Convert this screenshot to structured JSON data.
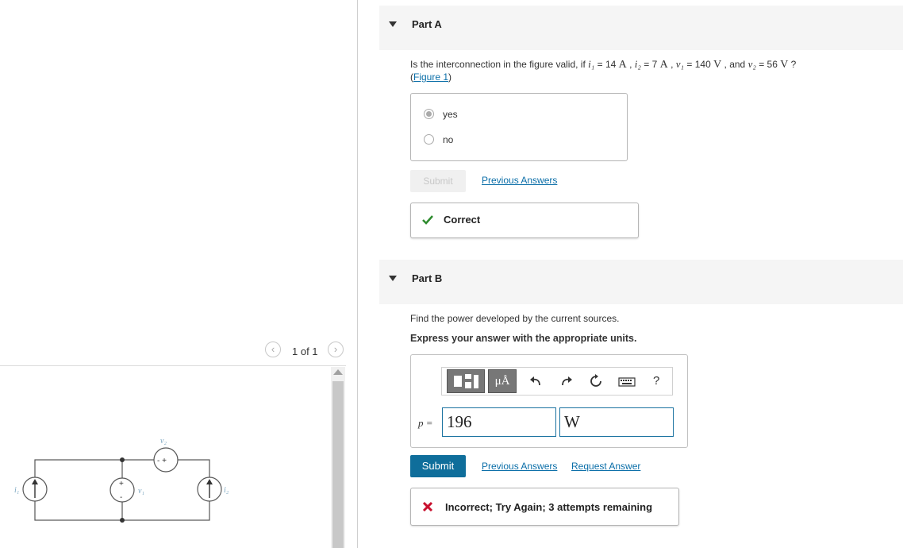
{
  "figure_nav": {
    "prev_icon": "chevron-left-icon",
    "next_icon": "chevron-right-icon",
    "page_count": "1 of 1"
  },
  "circuit": {
    "labels": {
      "i1": "i₁",
      "i2": "i₂",
      "v1": "v₁",
      "v2": "v₂",
      "plus": "+",
      "minus": "-",
      "v2_terms": "- +"
    }
  },
  "part_a": {
    "title": "Part A",
    "question": {
      "prefix": "Is the interconnection in the figure valid, if ",
      "i1_sym": "i₁",
      "i1_val": " = 14 ",
      "i1_unit": "A",
      "sep1": " , ",
      "i2_sym": "i₂",
      "i2_val": " = 7 ",
      "i2_unit": "A",
      "sep2": " , ",
      "v1_sym": "v₁",
      "v1_val": " = 140 ",
      "v1_unit": "V",
      "sep3": " , and ",
      "v2_sym": "v₂",
      "v2_val": " = 56 ",
      "v2_unit": "V",
      "suffix": " ?"
    },
    "figure_open": "(",
    "figure_link": "Figure 1",
    "figure_close": ")",
    "choices": [
      {
        "label": "yes",
        "selected": true
      },
      {
        "label": "no",
        "selected": false
      }
    ],
    "submit_label": "Submit",
    "previous_answers": "Previous Answers",
    "feedback": {
      "icon": "check-icon",
      "text": "Correct",
      "color": "#2e8b2e"
    }
  },
  "part_b": {
    "title": "Part B",
    "prompt": "Find the power developed by the current sources.",
    "instruction": "Express your answer with the appropriate units.",
    "toolbar": {
      "template_icon": "template-icon",
      "units_label": "μÅ",
      "undo_icon": "undo-icon",
      "redo_icon": "redo-icon",
      "reset_icon": "reset-icon",
      "keyboard_icon": "keyboard-icon",
      "help_label": "?"
    },
    "variable_label": "p =",
    "value": "196",
    "unit": "W",
    "submit_label": "Submit",
    "previous_answers": "Previous Answers",
    "request_answer": "Request Answer",
    "feedback": {
      "icon": "x-icon",
      "text": "Incorrect; Try Again; 3 attempts remaining",
      "color": "#c8102e"
    }
  },
  "colors": {
    "accent": "#0f6e9b",
    "link": "#0a6ea8",
    "correct": "#2e8b2e",
    "incorrect": "#c8102e"
  }
}
